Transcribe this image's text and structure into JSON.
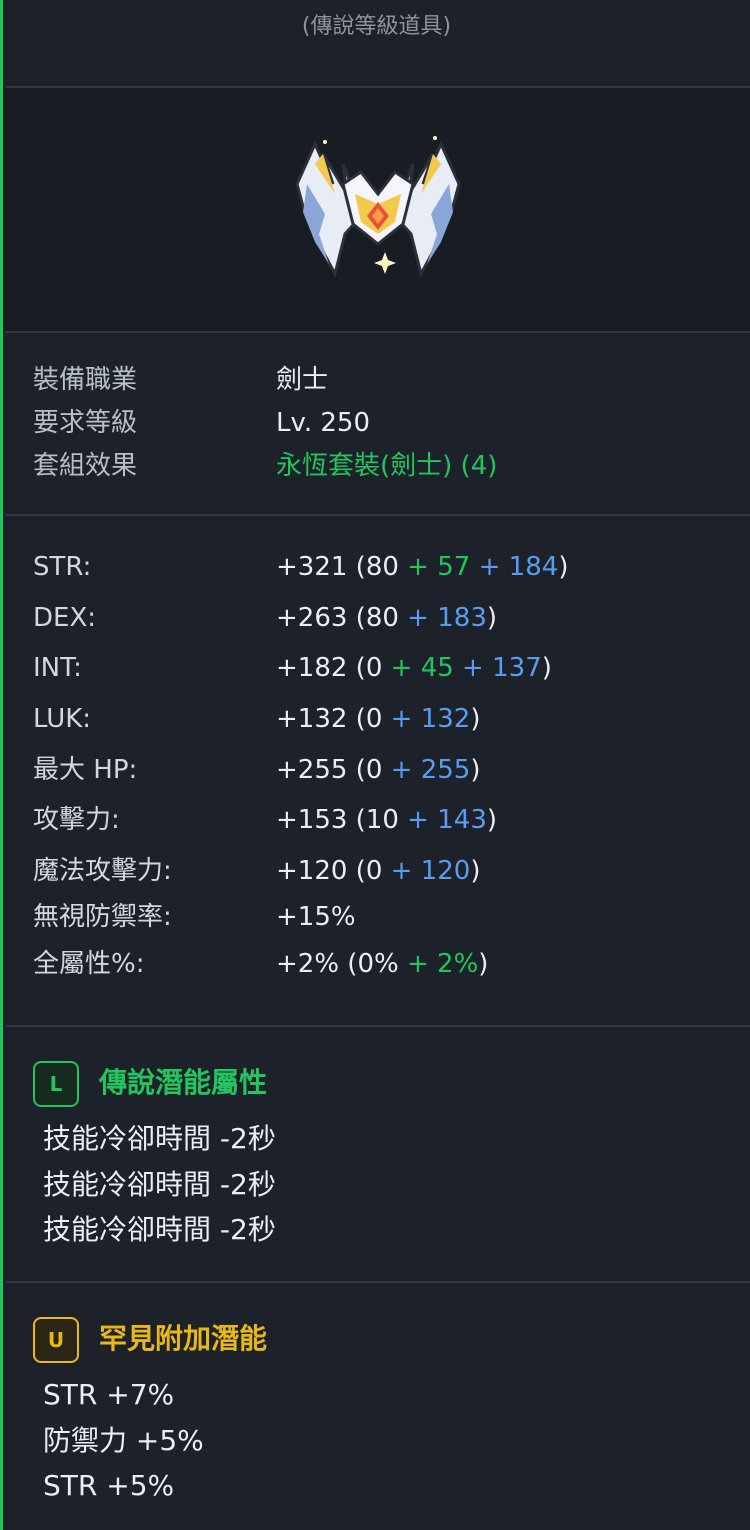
{
  "header": {
    "rarity": "(傳說等級道具)"
  },
  "item": {
    "icon": "emblem-icon"
  },
  "info": [
    {
      "label": "裝備職業",
      "value": "劍士"
    },
    {
      "label": "要求等級",
      "value": "Lv. 250"
    },
    {
      "label": "套組效果",
      "value": "永恆套裝(劍士) (4)"
    }
  ],
  "stats": [
    {
      "label": "STR:",
      "total": "+321",
      "open": " (80",
      "green_sep": " + ",
      "green": "57",
      "blue_sep": " + ",
      "blue": "184",
      "close": ")"
    },
    {
      "label": "DEX:",
      "total": "+263",
      "open": " (80",
      "green_sep": "",
      "green": "",
      "blue_sep": " + ",
      "blue": "183",
      "close": ")"
    },
    {
      "label": "INT:",
      "total": "+182",
      "open": " (0",
      "green_sep": " + ",
      "green": "45",
      "blue_sep": " + ",
      "blue": "137",
      "close": ")"
    },
    {
      "label": "LUK:",
      "total": "+132",
      "open": " (0",
      "green_sep": "",
      "green": "",
      "blue_sep": " + ",
      "blue": "132",
      "close": ")"
    },
    {
      "label": "最大 HP:",
      "total": "+255",
      "open": " (0",
      "green_sep": "",
      "green": "",
      "blue_sep": " + ",
      "blue": "255",
      "close": ")"
    },
    {
      "label": "攻擊力:",
      "total": "+153",
      "open": " (10",
      "green_sep": "",
      "green": "",
      "blue_sep": " + ",
      "blue": "143",
      "close": ")"
    },
    {
      "label": "魔法攻擊力:",
      "total": "+120",
      "open": " (0",
      "green_sep": "",
      "green": "",
      "blue_sep": " + ",
      "blue": "120",
      "close": ")"
    },
    {
      "label": "無視防禦率:",
      "total": "+15%",
      "open": "",
      "green_sep": "",
      "green": "",
      "blue_sep": "",
      "blue": "",
      "close": ""
    },
    {
      "label": "全屬性%:",
      "total": "+2%",
      "open": " (0%",
      "green_sep": " + ",
      "green": "2%",
      "blue_sep": "",
      "blue": "",
      "close": ")"
    }
  ],
  "potential": {
    "badge": "L",
    "title": "傳說潛能屬性",
    "lines": [
      "技能冷卻時間 -2秒",
      "技能冷卻時間 -2秒",
      "技能冷卻時間 -2秒"
    ]
  },
  "additional": {
    "badge": "U",
    "title": "罕見附加潛能",
    "lines": [
      "STR +7%",
      "防禦力 +5%",
      "STR +5%"
    ]
  },
  "colors": {
    "accent": "#22c55e",
    "bonus_blue": "#5b9cf0",
    "unique_gold": "#e8b71a",
    "background": "#1d2129"
  }
}
